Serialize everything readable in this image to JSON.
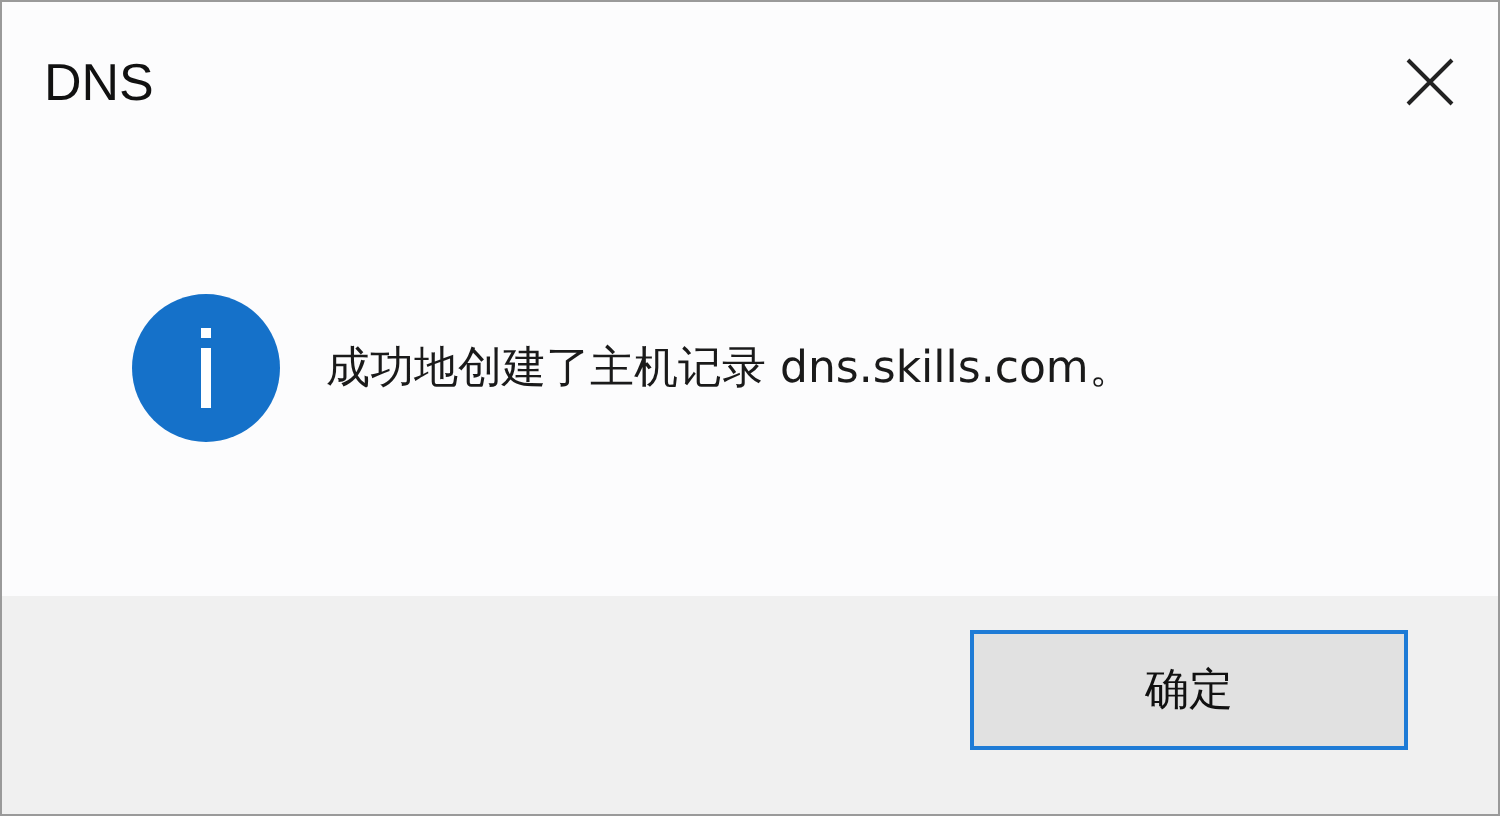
{
  "window": {
    "title": "DNS"
  },
  "message": {
    "text": "成功地创建了主机记录 dns.skills.com。"
  },
  "buttons": [
    {
      "label": "确定"
    }
  ]
}
